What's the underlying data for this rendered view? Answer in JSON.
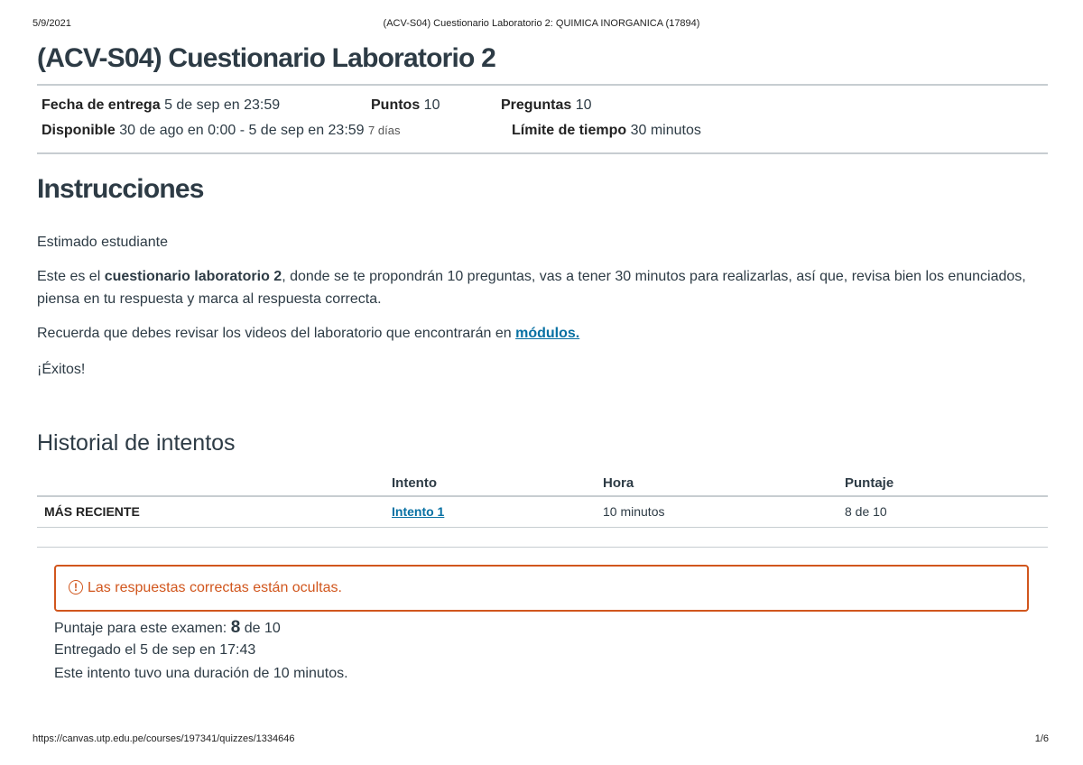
{
  "print_header": {
    "date": "5/9/2021",
    "title": "(ACV-S04) Cuestionario Laboratorio 2: QUIMICA INORGANICA (17894)"
  },
  "print_footer": {
    "url": "https://canvas.utp.edu.pe/courses/197341/quizzes/1334646",
    "page": "1/6"
  },
  "quiz": {
    "title": "(ACV-S04) Cuestionario Laboratorio 2",
    "meta": {
      "due_label": "Fecha de entrega",
      "due_value": "5 de sep en 23:59",
      "points_label": "Puntos",
      "points_value": "10",
      "questions_label": "Preguntas",
      "questions_value": "10",
      "available_label": "Disponible",
      "available_value": "30 de ago en 0:00 - 5 de sep en 23:59",
      "available_days": "7 días",
      "time_limit_label": "Límite de tiempo",
      "time_limit_value": "30 minutos"
    }
  },
  "instructions": {
    "heading": "Instrucciones",
    "greeting": "Estimado estudiante",
    "p1_pre": "Este es el ",
    "p1_bold": "cuestionario laboratorio 2",
    "p1_post": ", donde se te propondrán 10 preguntas, vas a tener 30 minutos para realizarlas, así que, revisa bien los enunciados, piensa en tu respuesta y marca al respuesta correcta.",
    "p2_pre": "Recuerda que debes revisar los videos del laboratorio que encontrarán en ",
    "p2_link": "módulos.",
    "closing": "¡Éxitos!"
  },
  "history": {
    "heading": "Historial de intentos",
    "columns": [
      "Intento",
      "Hora",
      "Puntaje"
    ],
    "rows": [
      {
        "label": "MÁS RECIENTE",
        "attempt": "Intento 1",
        "time": "10 minutos",
        "score": "8 de 10"
      }
    ]
  },
  "result": {
    "alert": "Las respuestas correctas están ocultas.",
    "alert_icon": "!",
    "score_pre": "Puntaje para este examen: ",
    "score_value": "8",
    "score_post": " de 10",
    "submitted": "Entregado el 5 de sep en 17:43",
    "duration": "Este intento tuvo una duración de 10 minutos."
  }
}
